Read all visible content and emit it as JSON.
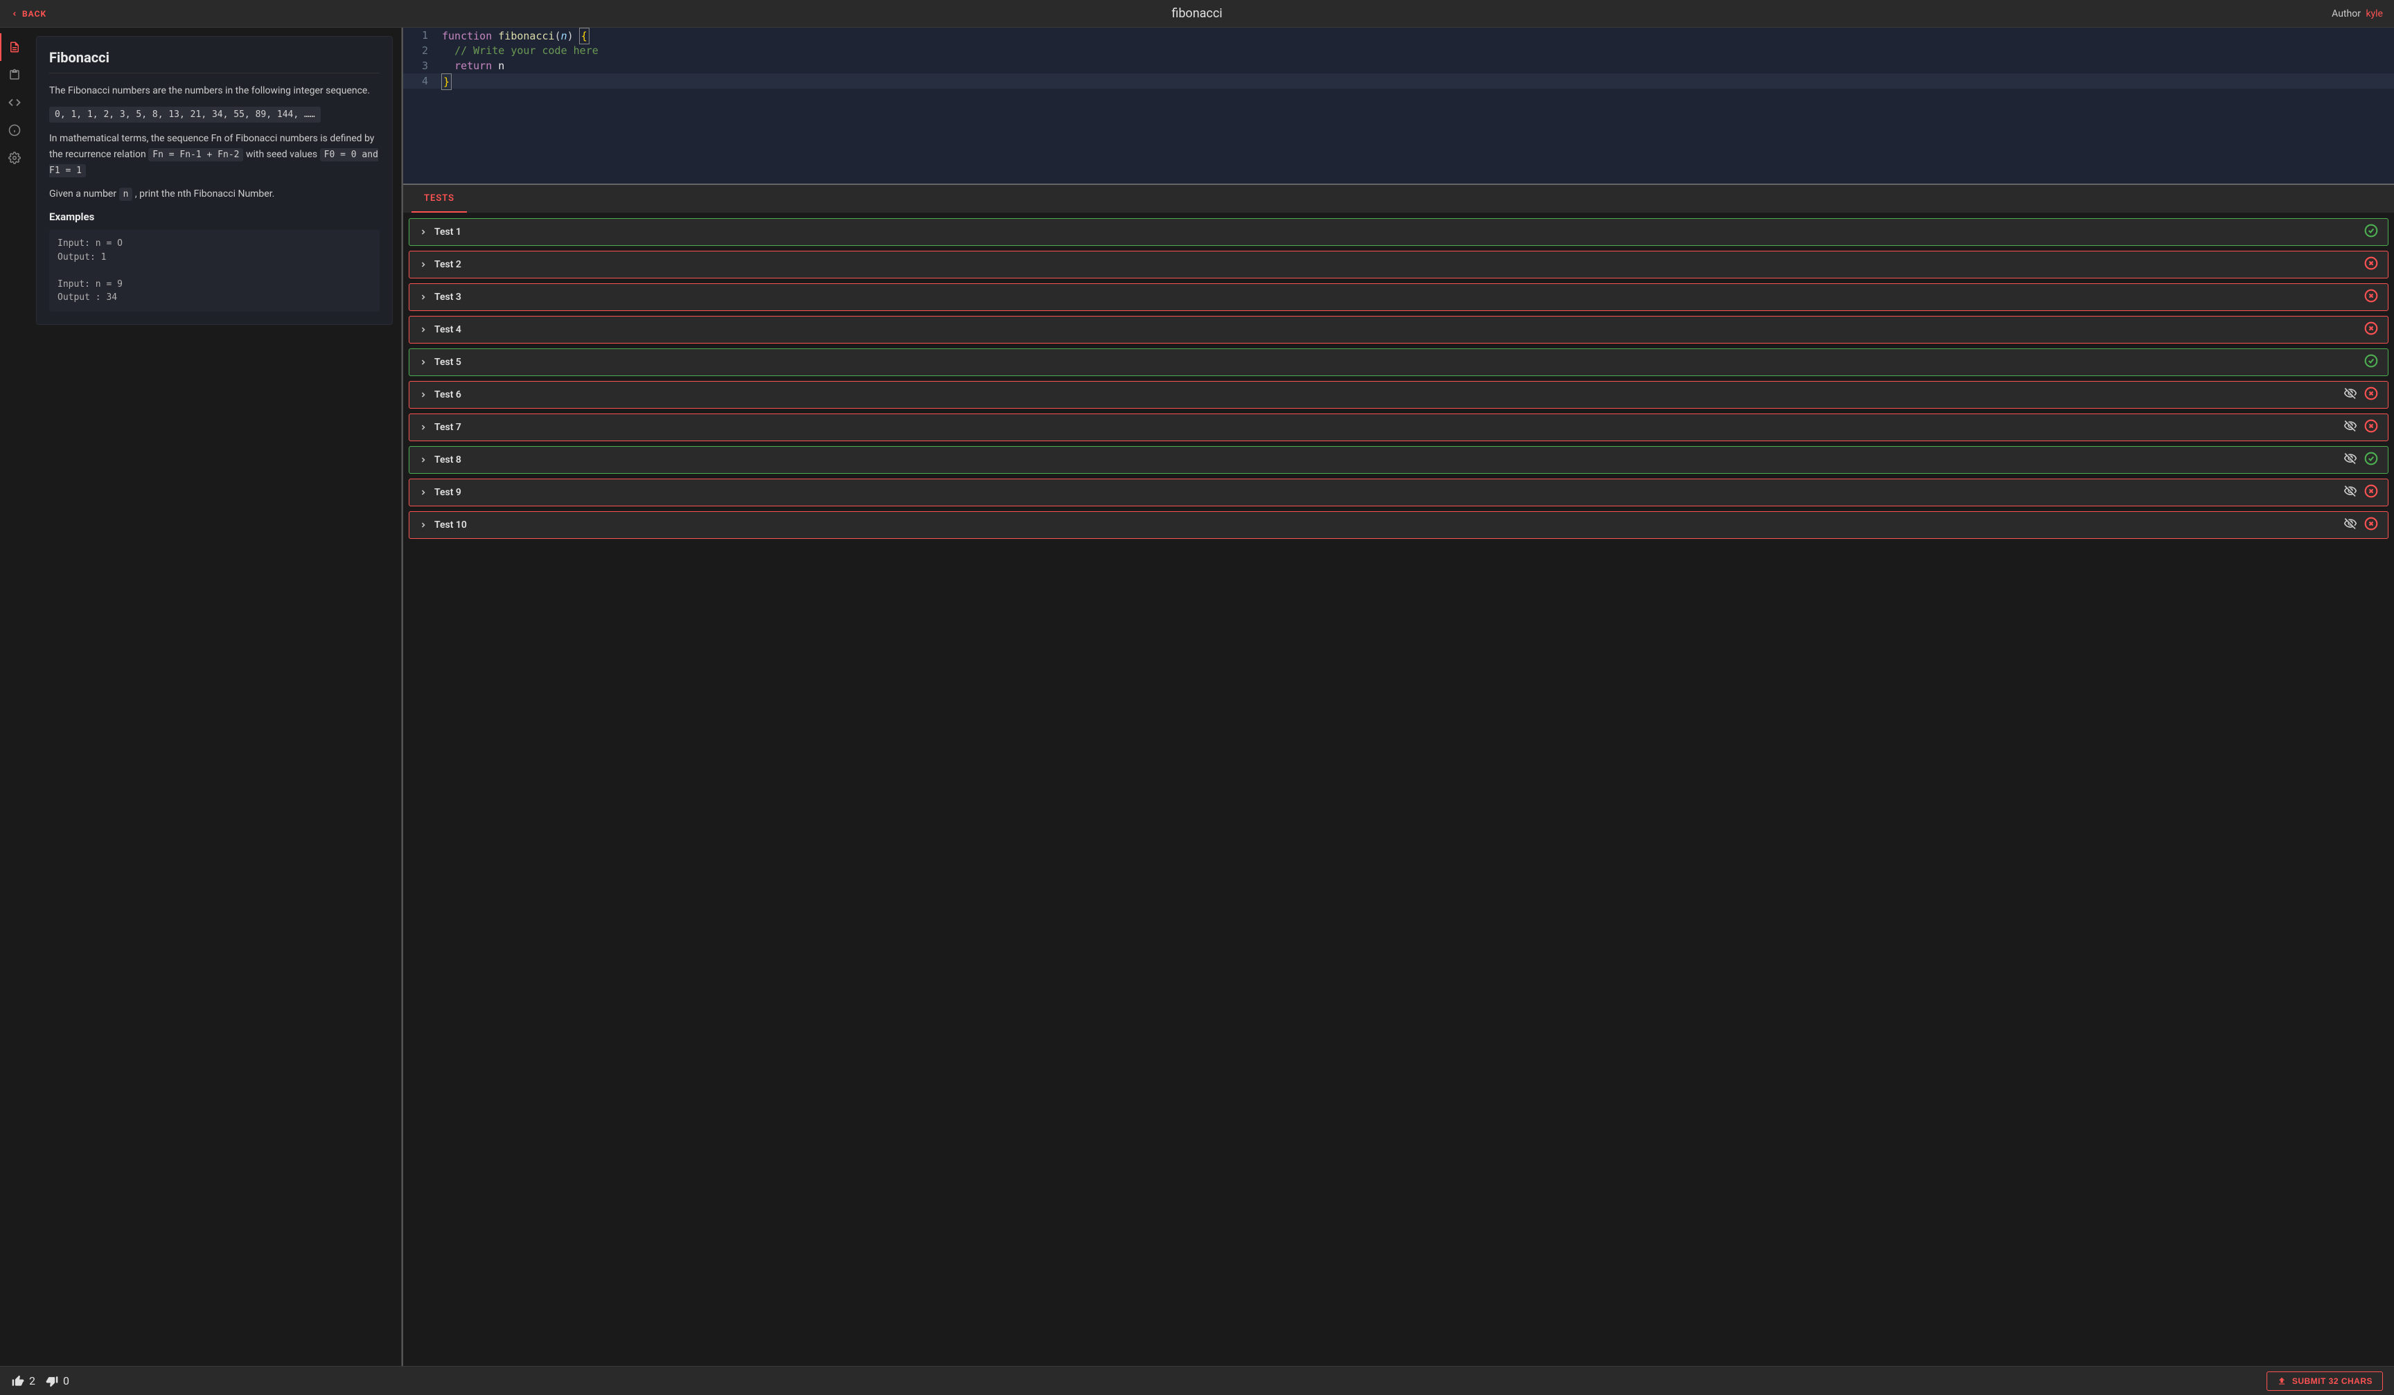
{
  "header": {
    "back_label": "BACK",
    "title": "fibonacci",
    "author_prefix": "Author",
    "author_name": "kyle"
  },
  "sidebar": {
    "items": [
      {
        "name": "description",
        "active": true
      },
      {
        "name": "clipboard",
        "active": false
      },
      {
        "name": "code",
        "active": false
      },
      {
        "name": "info",
        "active": false
      },
      {
        "name": "settings",
        "active": false
      }
    ]
  },
  "problem": {
    "title": "Fibonacci",
    "intro": "The Fibonacci numbers are the numbers in the following integer sequence.",
    "sequence": "0, 1, 1, 2, 3, 5, 8, 13, 21, 34, 55, 89, 144, ……",
    "math_prefix": "In mathematical terms, the sequence Fn of Fibonacci numbers is defined by the recurrence relation ",
    "recurrence": "Fn = Fn-1 + Fn-2",
    "seed_prefix": " with seed values ",
    "seed": "F0 = 0 and F1 = 1",
    "given_prefix": "Given a number ",
    "given_var": "n",
    "given_suffix": " , print the nth Fibonacci Number.",
    "examples_heading": "Examples",
    "examples_block": "Input: n = O\nOutput: 1\n\nInput: n = 9\nOutput : 34"
  },
  "editor": {
    "lines": [
      {
        "num": "1"
      },
      {
        "num": "2"
      },
      {
        "num": "3"
      },
      {
        "num": "4"
      }
    ],
    "code": {
      "l1_kw": "function",
      "l1_fn": "fibonacci",
      "l1_param": "n",
      "l2_comment": "// Write your code here",
      "l3_kw": "return",
      "l3_var": "n"
    }
  },
  "tests": {
    "tab_label": "TESTS",
    "rows": [
      {
        "label": "Test 1",
        "status": "pass",
        "hidden": false
      },
      {
        "label": "Test 2",
        "status": "fail",
        "hidden": false
      },
      {
        "label": "Test 3",
        "status": "fail",
        "hidden": false
      },
      {
        "label": "Test 4",
        "status": "fail",
        "hidden": false
      },
      {
        "label": "Test 5",
        "status": "pass",
        "hidden": false
      },
      {
        "label": "Test 6",
        "status": "fail",
        "hidden": true
      },
      {
        "label": "Test 7",
        "status": "fail",
        "hidden": true
      },
      {
        "label": "Test 8",
        "status": "pass",
        "hidden": true
      },
      {
        "label": "Test 9",
        "status": "fail",
        "hidden": true
      },
      {
        "label": "Test 10",
        "status": "fail",
        "hidden": true
      }
    ]
  },
  "footer": {
    "upvotes": "2",
    "downvotes": "0",
    "submit_label": "SUBMIT 32 CHARS"
  }
}
